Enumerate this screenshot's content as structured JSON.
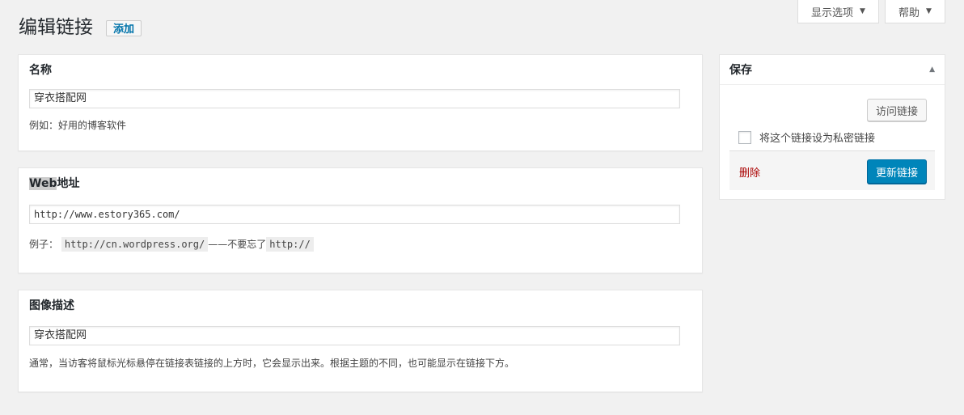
{
  "screen_tabs": {
    "options": "显示选项",
    "help": "帮助"
  },
  "header": {
    "title": "编辑链接",
    "add_new": "添加"
  },
  "name_box": {
    "title": "名称",
    "value": "穿衣搭配网",
    "desc": "例如：好用的博客软件"
  },
  "url_box": {
    "title_prefix": "Web",
    "title_suffix": "地址",
    "value": "http://www.estory365.com/",
    "desc_prefix": "例子：",
    "desc_code1": "http://cn.wordpress.org/",
    "desc_mid": "——不要忘了",
    "desc_code2": "http://"
  },
  "desc_box": {
    "title": "图像描述",
    "value": "穿衣搭配网",
    "desc": "通常，当访客将鼠标光标悬停在链接表链接的上方时，它会显示出来。根据主题的不同，也可能显示在链接下方。"
  },
  "save_box": {
    "title": "保存",
    "visit": "访问链接",
    "private_label": "将这个链接设为私密链接",
    "private_checked": false,
    "delete": "删除",
    "update": "更新链接"
  },
  "colors": {
    "primary_button": "#0085ba",
    "delete_link": "#aa0000",
    "link_blue": "#0073aa"
  }
}
